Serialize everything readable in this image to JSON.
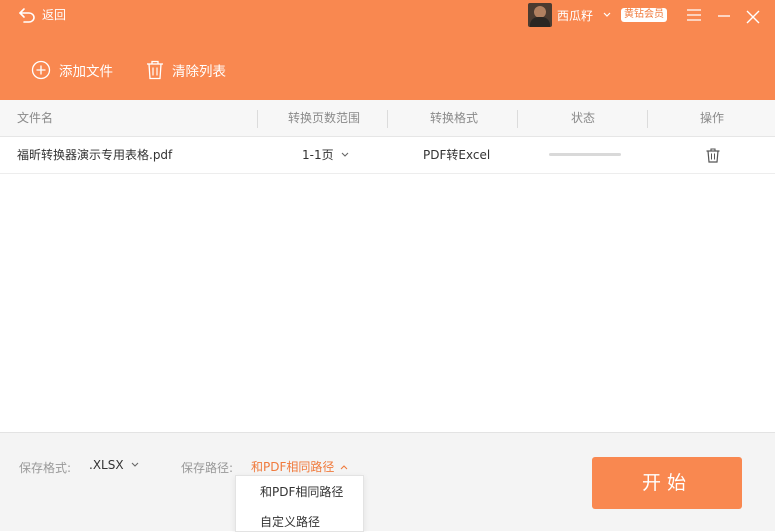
{
  "header": {
    "back_label": "返回",
    "user_name": "西瓜籽",
    "vip_badge": "黄钻会员",
    "add_file_label": "添加文件",
    "clear_list_label": "清除列表"
  },
  "table": {
    "columns": [
      "文件名",
      "转换页数范围",
      "转换格式",
      "状态",
      "操作"
    ],
    "rows": [
      {
        "file_name": "福昕转换器演示专用表格.pdf",
        "page_range": "1-1页",
        "format": "PDF转Excel",
        "progress": 0
      }
    ]
  },
  "footer": {
    "save_format_label": "保存格式:",
    "save_format_value": ".XLSX",
    "save_path_label": "保存路径:",
    "save_path_value": "和PDF相同路径",
    "start_label": "开始"
  },
  "path_dropdown": {
    "options": [
      "和PDF相同路径",
      "自定义路径"
    ]
  },
  "colors": {
    "accent": "#f98850",
    "accent_text": "#f07a3c"
  }
}
